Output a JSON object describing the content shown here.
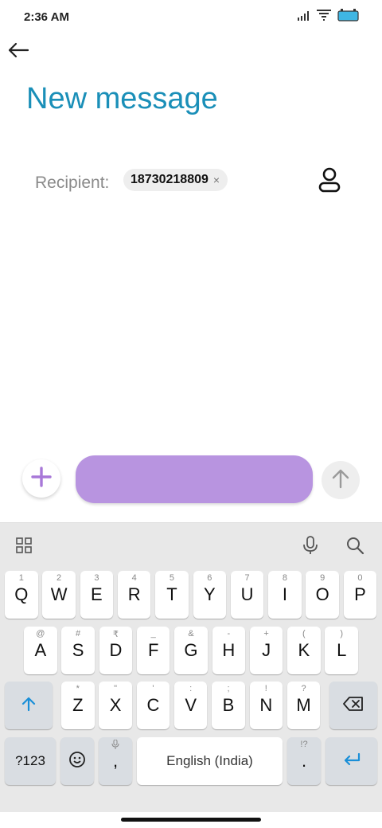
{
  "status_bar": {
    "time": "2:36 AM",
    "icons": [
      "signal-icon",
      "wifi-icon",
      "battery-icon"
    ],
    "battery_color": "#3fb6e4"
  },
  "header": {
    "title": "New message",
    "back_icon": "arrow-left-icon"
  },
  "recipient": {
    "label": "Recipient:",
    "chip_value": "18730218809",
    "chip_remove": "×",
    "contact_icon": "person-icon"
  },
  "compose": {
    "add_icon": "plus-icon",
    "field_value": "",
    "field_color": "#b894e0",
    "send_icon": "arrow-up-icon"
  },
  "keyboard": {
    "toolbar": [
      "grid-icon",
      "microphone-icon",
      "search-icon"
    ],
    "row1": [
      {
        "k": "Q",
        "h": "1"
      },
      {
        "k": "W",
        "h": "2"
      },
      {
        "k": "E",
        "h": "3"
      },
      {
        "k": "R",
        "h": "4"
      },
      {
        "k": "T",
        "h": "5"
      },
      {
        "k": "Y",
        "h": "6"
      },
      {
        "k": "U",
        "h": "7"
      },
      {
        "k": "I",
        "h": "8"
      },
      {
        "k": "O",
        "h": "9"
      },
      {
        "k": "P",
        "h": "0"
      }
    ],
    "row2": [
      {
        "k": "A",
        "h": "@"
      },
      {
        "k": "S",
        "h": "#"
      },
      {
        "k": "D",
        "h": "₹"
      },
      {
        "k": "F",
        "h": "_"
      },
      {
        "k": "G",
        "h": "&"
      },
      {
        "k": "H",
        "h": "-"
      },
      {
        "k": "J",
        "h": "+"
      },
      {
        "k": "K",
        "h": "("
      },
      {
        "k": "L",
        "h": ")"
      }
    ],
    "row3": [
      {
        "k": "Z",
        "h": "*"
      },
      {
        "k": "X",
        "h": "\""
      },
      {
        "k": "C",
        "h": "'"
      },
      {
        "k": "V",
        "h": ":"
      },
      {
        "k": "B",
        "h": ";"
      },
      {
        "k": "N",
        "h": "!"
      },
      {
        "k": "M",
        "h": "?"
      }
    ],
    "symbols_label": "?123",
    "comma": ",",
    "space_label": "English (India)",
    "period": ".",
    "period_hint": "!?",
    "accent_color": "#1a8fd8"
  }
}
